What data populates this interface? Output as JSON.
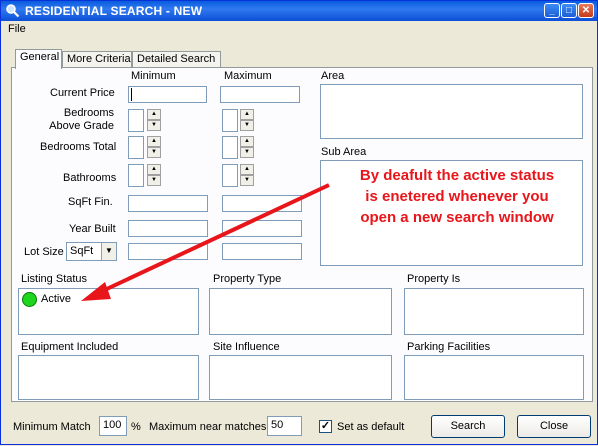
{
  "window": {
    "title": "RESIDENTIAL SEARCH - NEW",
    "min_label": "_",
    "max_label": "□",
    "close_label": "✕"
  },
  "menu": {
    "file": "File"
  },
  "tabs": [
    {
      "label": "General"
    },
    {
      "label": "More Criteria"
    },
    {
      "label": "Detailed Search"
    }
  ],
  "general": {
    "minimum_label": "Minimum",
    "maximum_label": "Maximum",
    "area_label": "Area",
    "sub_area_label": "Sub Area",
    "current_price_label": "Current Price",
    "bedrooms_above_label_1": "Bedrooms",
    "bedrooms_above_label_2": "Above Grade",
    "bedrooms_total_label": "Bedrooms Total",
    "bathrooms_label": "Bathrooms",
    "sqft_label": "SqFt Fin.",
    "year_built_label": "Year Built",
    "lot_size_label": "Lot Size",
    "lot_size_unit": "SqFt",
    "listing_status_label": "Listing Status",
    "listing_status_value": "Active",
    "property_type_label": "Property Type",
    "property_is_label": "Property Is",
    "equipment_label": "Equipment Included",
    "site_influence_label": "Site Influence",
    "parking_label": "Parking Facilities"
  },
  "annotation": {
    "line1": "By deafult the active status",
    "line2": "is enetered whenever you",
    "line3": "open a new search window",
    "color": "#e8151b"
  },
  "bottom": {
    "min_match_label": "Minimum Match",
    "min_match_value": "100",
    "percent": "%",
    "max_near_label": "Maximum near matches",
    "max_near_value": "50",
    "set_default_label": "Set as default",
    "set_default_checked": true,
    "search_label": "Search",
    "close_label": "Close"
  }
}
